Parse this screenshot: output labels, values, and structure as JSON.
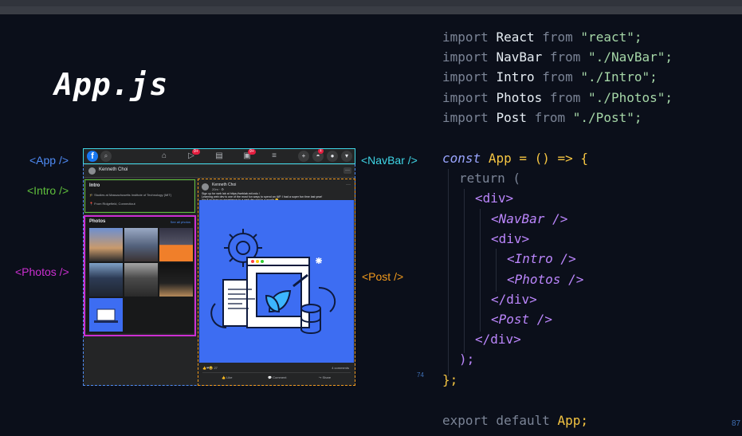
{
  "slide": {
    "title": "App.js",
    "labels": {
      "app": "<App />",
      "intro": "<Intro />",
      "photos": "<Photos />",
      "navbar": "<NavBar />",
      "post": "<Post />"
    },
    "page_number_small": "74",
    "page_number": "87"
  },
  "colors": {
    "app": "#4f8cf7",
    "intro": "#5fbf3c",
    "photos": "#cc2fd1",
    "navbar": "#3fd6e6",
    "post": "#f29a1d",
    "facebook_blue": "#1877f2",
    "illustration_bg": "#3d6df2"
  },
  "facebook_mock": {
    "nav_badges": [
      "9+",
      "9+",
      "1"
    ],
    "profile_name": "Kenneth Choi",
    "intro": {
      "title": "Intro",
      "studies": "Studies at Massachusetts Institute of Technology (MIT)",
      "from": "From Ridgefield, Connecticut"
    },
    "photos": {
      "title": "Photos",
      "see_all": "See all photos"
    },
    "post": {
      "author": "Kenneth Choi",
      "time": "20m · ⚙",
      "text_line1": "Sign up for web lab at https://weblab.mit.edu !",
      "text_line2": "Learning web dev is one of the most fun ways to spend an IAP. I had a super fun time last year!",
      "text_line3": "You'll go from no experience to a web dev god in a month 😊",
      "reactions_count": "27",
      "comments_count": "4 comments",
      "actions": [
        "Like",
        "Comment",
        "Share"
      ]
    }
  },
  "code": {
    "line1": {
      "kw": "import",
      "id": "React",
      "from": "from",
      "str": "\"react\";"
    },
    "line2": {
      "kw": "import",
      "id": "NavBar",
      "from": "from",
      "str": "\"./NavBar\";"
    },
    "line3": {
      "kw": "import",
      "id": "Intro",
      "from": "from",
      "str": "\"./Intro\";"
    },
    "line4": {
      "kw": "import",
      "id": "Photos",
      "from": "from",
      "str": "\"./Photos\";"
    },
    "line5": {
      "kw": "import",
      "id": "Post",
      "from": "from",
      "str": "\"./Post\";"
    },
    "const_kw": "const",
    "app_name": "App",
    "arrow": "= () => {",
    "return_line": "return (",
    "div_open": "<div>",
    "navbar_tag": "<NavBar />",
    "div_open_inner": "<div>",
    "intro_tag": "<Intro />",
    "photos_tag": "<Photos />",
    "div_close_inner": "</div>",
    "post_tag": "<Post />",
    "div_close": "</div>",
    "paren_close": ");",
    "brace_close": "};",
    "export_line": {
      "kw": "export default",
      "id": "App;"
    }
  }
}
